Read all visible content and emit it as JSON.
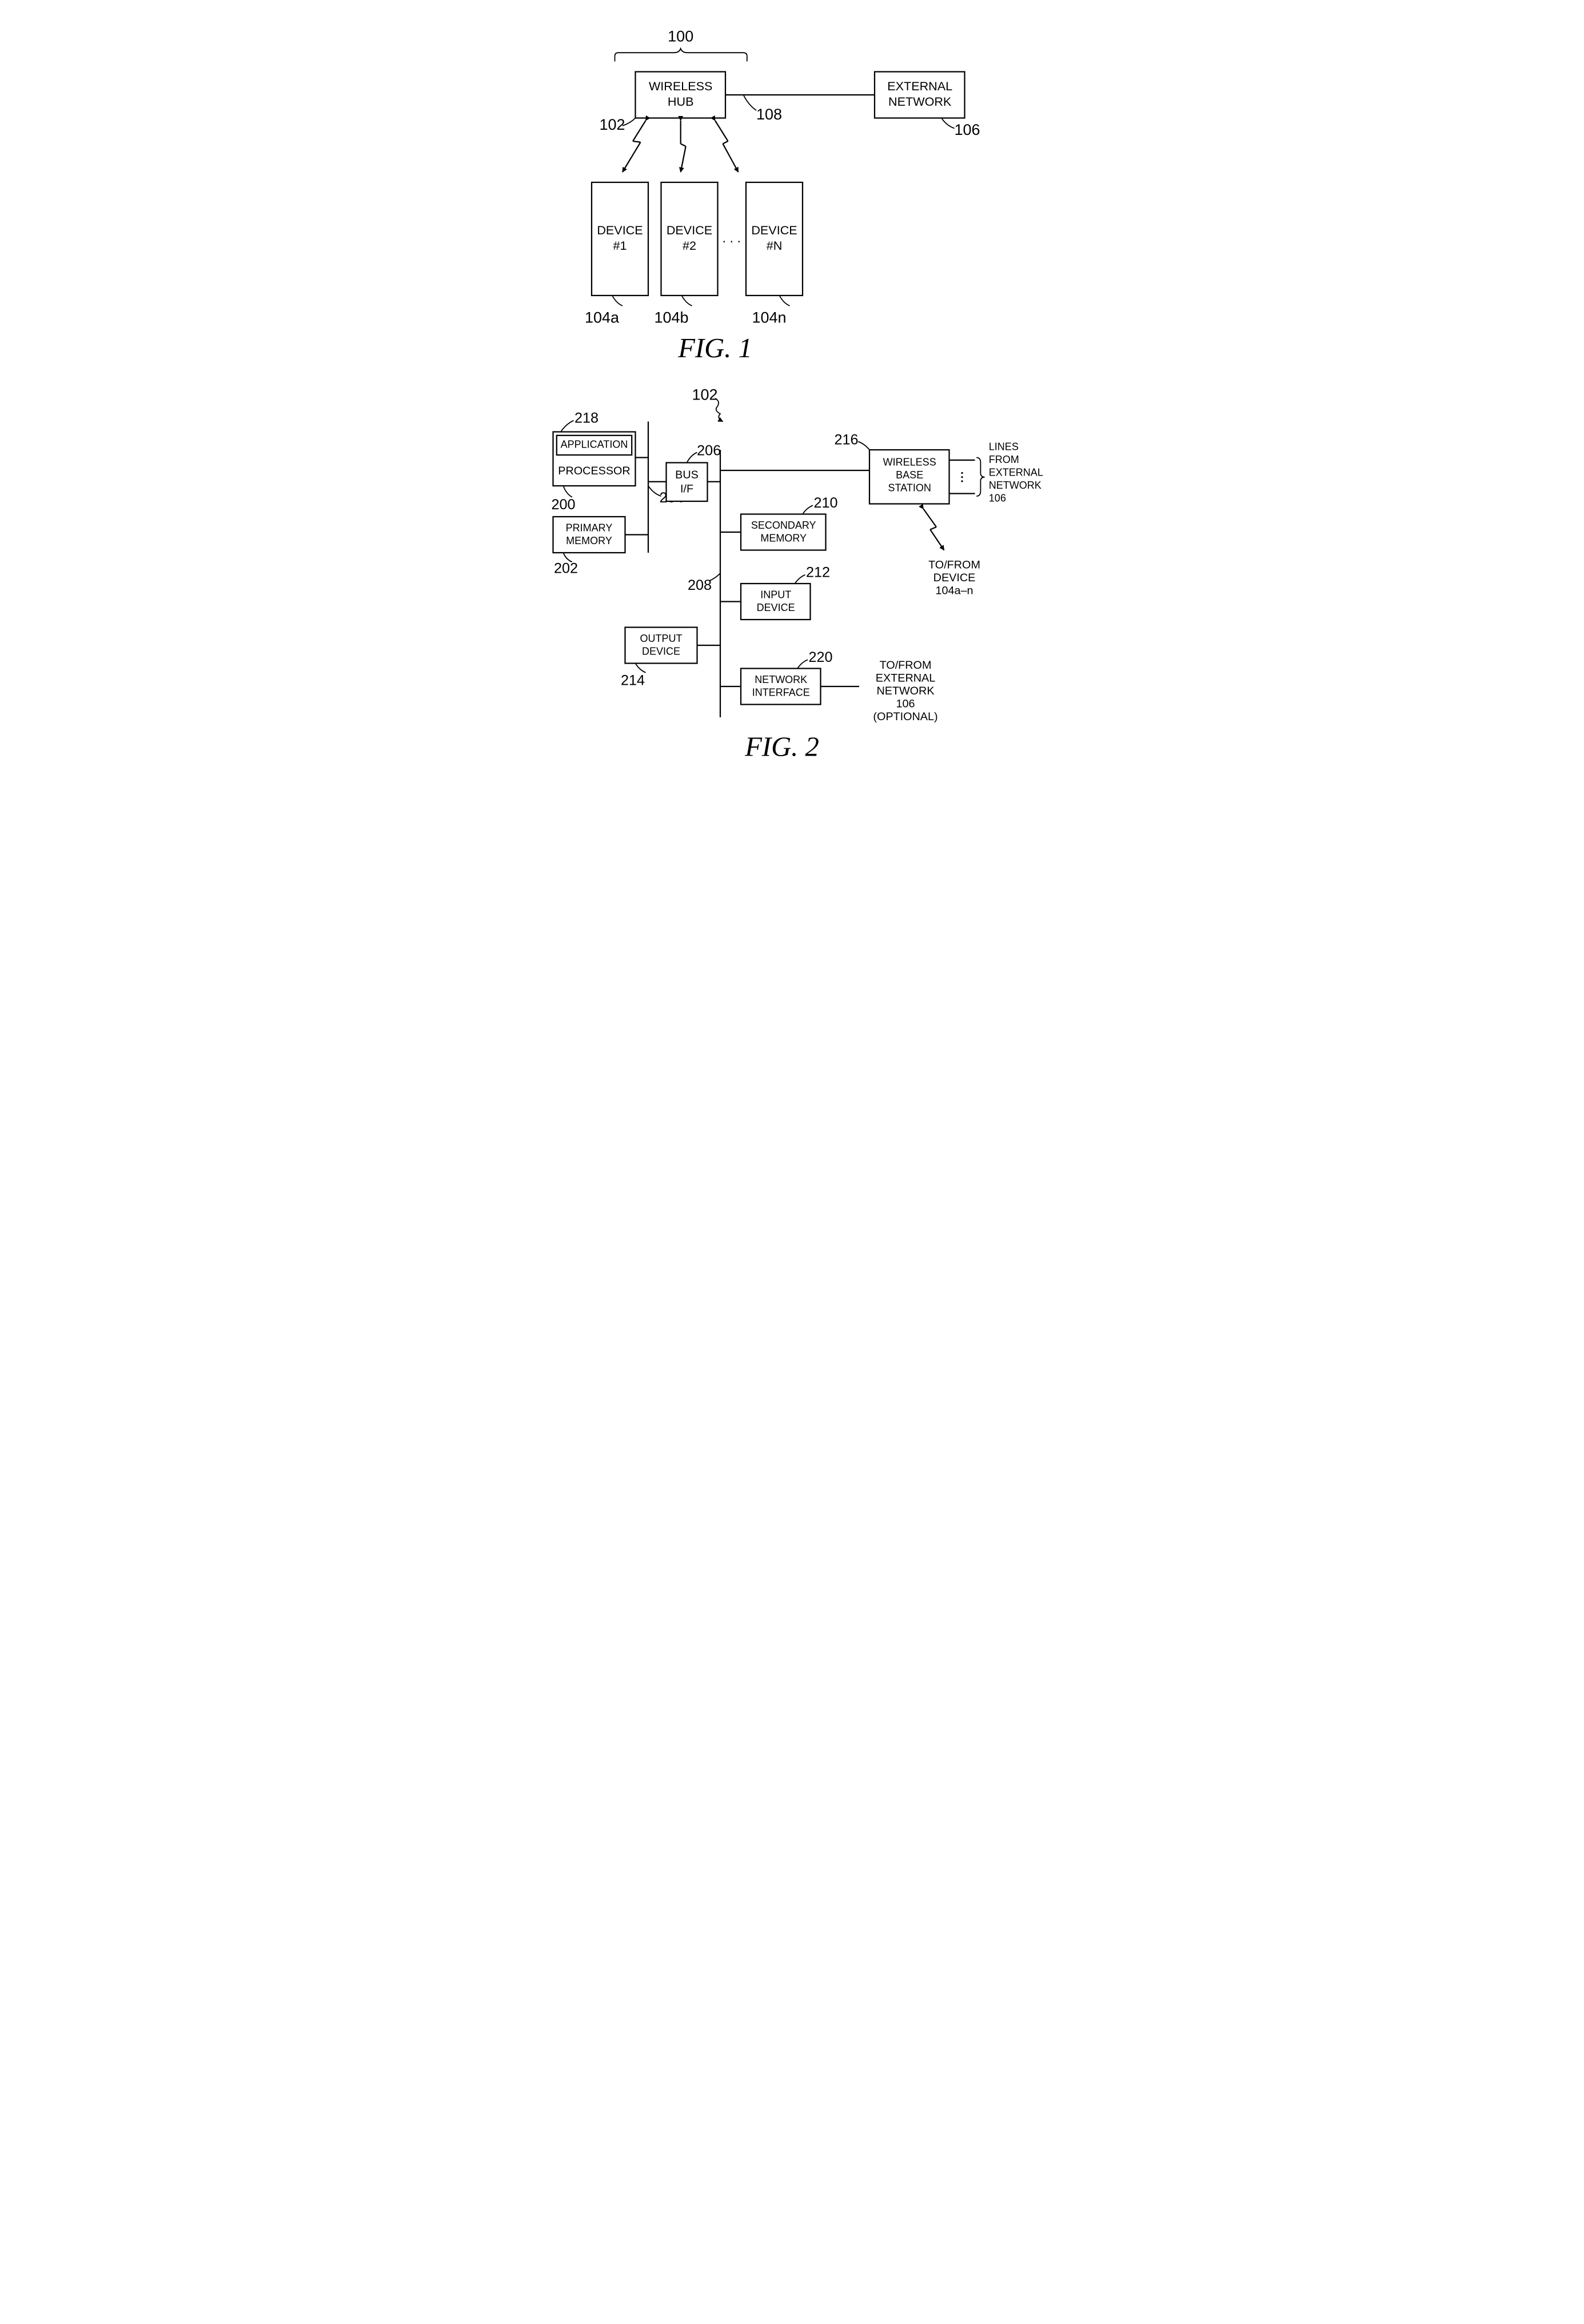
{
  "fig1": {
    "title": "FIG.  1",
    "ref100": "100",
    "hub": {
      "label1": "WIRELESS",
      "label2": "HUB",
      "ref": "102"
    },
    "ext": {
      "label1": "EXTERNAL",
      "label2": "NETWORK",
      "ref": "106"
    },
    "linkRef": "108",
    "devices": [
      {
        "l1": "DEVICE",
        "l2": "#1",
        "ref": "104a"
      },
      {
        "l1": "DEVICE",
        "l2": "#2",
        "ref": "104b"
      },
      {
        "l1": "DEVICE",
        "l2": "#N",
        "ref": "104n"
      }
    ],
    "ellipsis": ". . ."
  },
  "fig2": {
    "title": "FIG.  2",
    "ref102": "102",
    "processor": {
      "app": "APPLICATION",
      "proc": "PROCESSOR",
      "ref": "200",
      "refApp": "218"
    },
    "primMem": {
      "l1": "PRIMARY",
      "l2": "MEMORY",
      "ref": "202"
    },
    "busIF": {
      "l1": "BUS",
      "l2": "I/F",
      "ref": "206"
    },
    "bus1Ref": "204",
    "bus2Ref": "208",
    "secMem": {
      "l1": "SECONDARY",
      "l2": "MEMORY",
      "ref": "210"
    },
    "input": {
      "l1": "INPUT",
      "l2": "DEVICE",
      "ref": "212"
    },
    "output": {
      "l1": "OUTPUT",
      "l2": "DEVICE",
      "ref": "214"
    },
    "netIF": {
      "l1": "NETWORK",
      "l2": "INTERFACE",
      "ref": "220"
    },
    "wbs": {
      "l1": "WIRELESS",
      "l2": "BASE",
      "l3": "STATION",
      "ref": "216"
    },
    "linesFrom": {
      "l1": "LINES",
      "l2": "FROM",
      "l3": "EXTERNAL",
      "l4": "NETWORK",
      "l5": "106"
    },
    "toDevice": {
      "l1": "TO/FROM",
      "l2": "DEVICE",
      "l3": "104a–n"
    },
    "toExt": {
      "l1": "TO/FROM",
      "l2": "EXTERNAL",
      "l3": "NETWORK",
      "l4": "106",
      "l5": "(OPTIONAL)"
    }
  }
}
